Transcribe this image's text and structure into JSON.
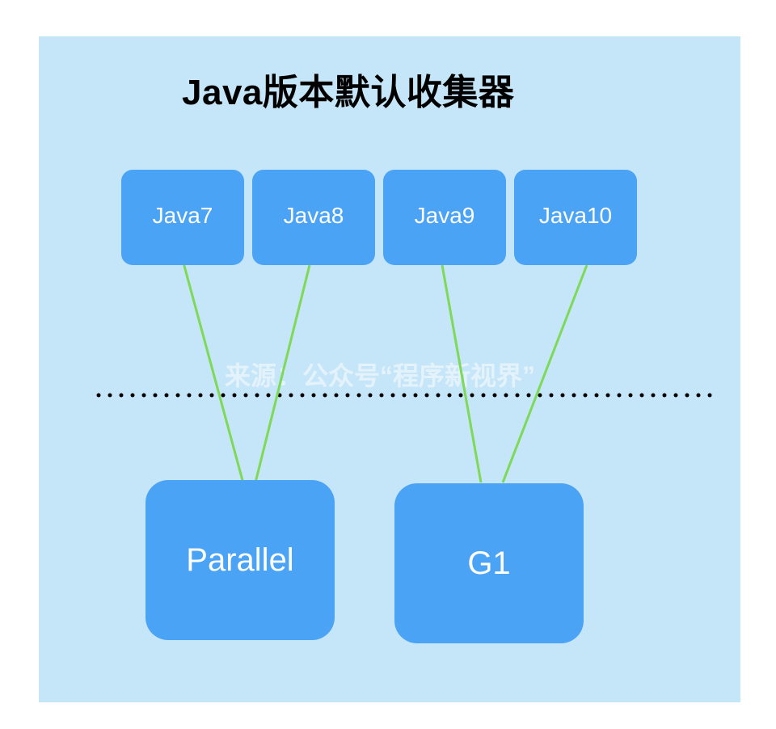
{
  "diagram": {
    "title": "Java版本默认收集器",
    "versions": [
      {
        "id": "java7",
        "label": "Java7"
      },
      {
        "id": "java8",
        "label": "Java8"
      },
      {
        "id": "java9",
        "label": "Java9"
      },
      {
        "id": "java10",
        "label": "Java10"
      }
    ],
    "collectors": [
      {
        "id": "parallel",
        "label": "Parallel"
      },
      {
        "id": "g1",
        "label": "G1"
      }
    ],
    "edges": [
      {
        "from": "Java7",
        "to": "Parallel"
      },
      {
        "from": "Java8",
        "to": "Parallel"
      },
      {
        "from": "Java9",
        "to": "G1"
      },
      {
        "from": "Java10",
        "to": "G1"
      }
    ],
    "watermark": "来源：公众号“程序新视界”",
    "colors": {
      "panel_background": "#c5e5f8",
      "node_fill": "#4aa3f5",
      "node_text": "#ffffff",
      "edge": "#7ed957",
      "divider": "#000000"
    }
  }
}
